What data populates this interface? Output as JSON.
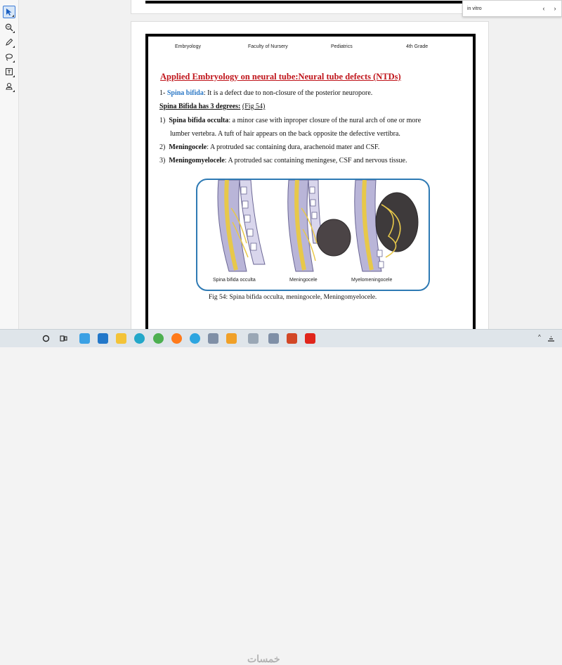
{
  "find": {
    "query": "in vitro",
    "prev_label": "‹",
    "next_label": "›"
  },
  "document": {
    "header": {
      "subject": "Embryology",
      "faculty": "Faculty of Nursery",
      "department": "Pediatrics",
      "grade": "4th Grade"
    },
    "heading": "Applied Embryology on neural tube:Neural tube defects (NTDs)",
    "spina_bifida": {
      "number": "1-",
      "term": "Spina bifida",
      "definition": ": It is a defect due to non-closure of the posterior neuropore."
    },
    "degrees_title": "Spina Bifida has 3 degrees:",
    "degrees_ref": "(Fig 54)",
    "degrees": [
      {
        "num": "1)",
        "term": "Spina bifida occulta",
        "text": ": a minor case with inproper closure of the nural arch of one or more",
        "text2": "lumber vertebra. A tuft of hair appears on the back opposite the defective vertibra."
      },
      {
        "num": "2)",
        "term": "Meningocele",
        "text": ": A protruded sac containing dura, arachenoid mater and CSF."
      },
      {
        "num": "3)",
        "term": "Meningomyelocele",
        "text": ": A protruded sac containing meningese, CSF and nervous tissue."
      }
    ],
    "figure_labels": [
      "Spina bifida occulta",
      "Meningocele",
      "Myelomeningocele"
    ],
    "caption": "Fig 54: Spina bifida occulta, meningocele, Meningomyelocele."
  },
  "taskbar": {
    "watermark": "خمسات"
  },
  "colors": {
    "heading": "#c0151b",
    "term_blue": "#2b78c6",
    "figure_border": "#2e7ab4"
  }
}
